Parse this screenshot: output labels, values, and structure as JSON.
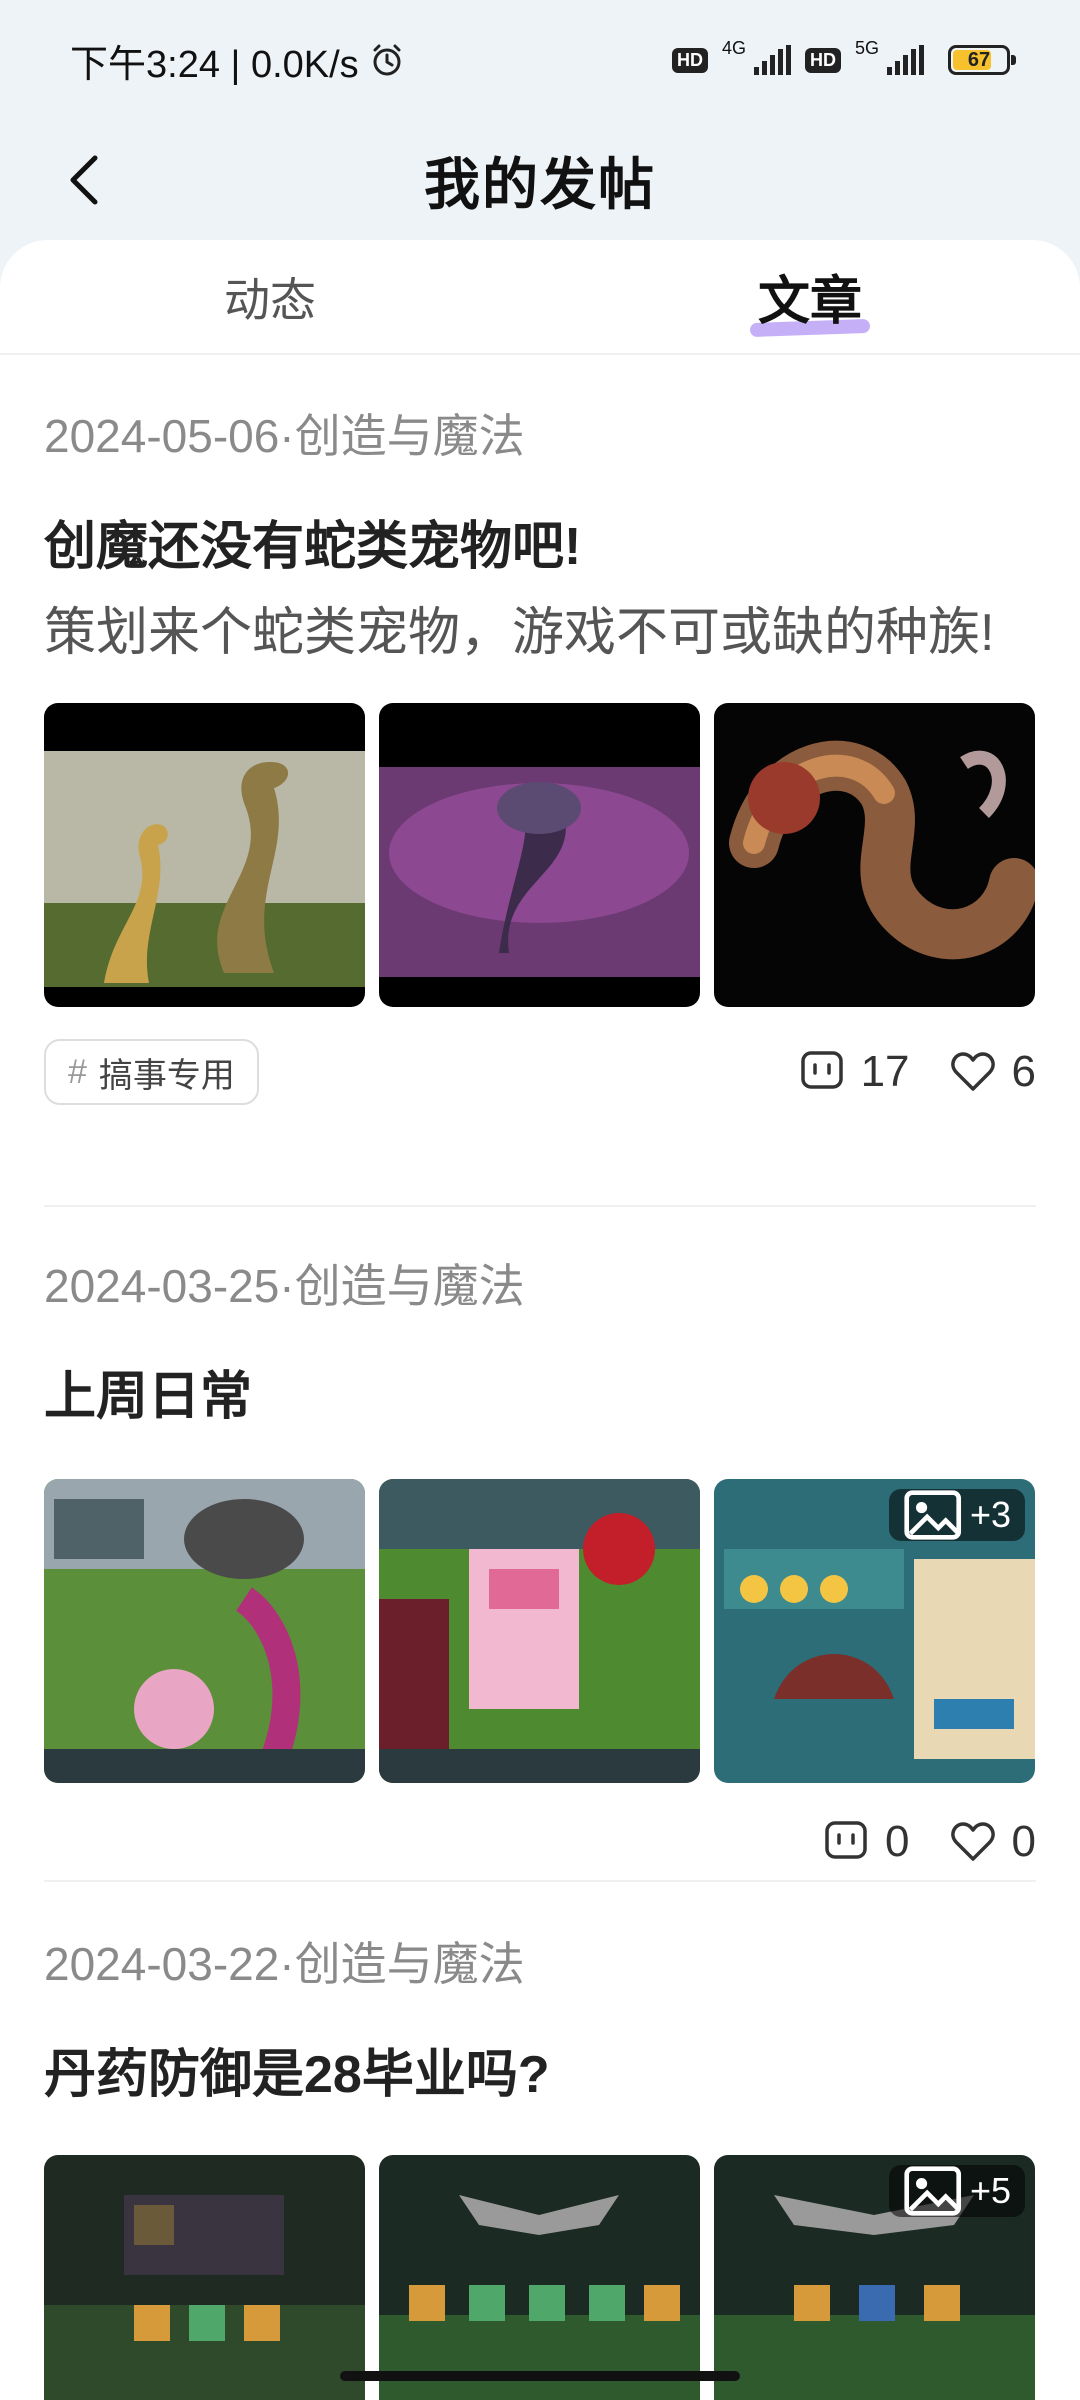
{
  "status_bar": {
    "time_speed": "下午3:24 | 0.0K/s",
    "hd1": "HD",
    "net1": "4G",
    "hd2": "HD",
    "net2": "5G",
    "battery": "67"
  },
  "header": {
    "title": "我的发帖"
  },
  "tabs": [
    {
      "label": "动态",
      "active": false
    },
    {
      "label": "文章",
      "active": true
    }
  ],
  "posts": [
    {
      "meta": "2024-05-06·创造与魔法",
      "title": "创魔还没有蛇类宠物吧!",
      "body": "策划来个蛇类宠物，游戏不可或缺的种族!",
      "tag": "搞事专用",
      "comments": "17",
      "likes": "6",
      "images": [
        "golden-cobra-image",
        "purple-serpent-image",
        "dragon-serpent-image"
      ]
    },
    {
      "meta": "2024-03-25·创造与魔法",
      "title": "上周日常",
      "comments": "0",
      "likes": "0",
      "more_count": "+3",
      "images": [
        "game-screenshot-1",
        "game-screenshot-2",
        "game-screenshot-3"
      ]
    },
    {
      "meta": "2024-03-22·创造与魔法",
      "title": "丹药防御是28毕业吗?",
      "more_count": "+5",
      "images": [
        "crafting-screenshot-1",
        "crafting-screenshot-2",
        "crafting-screenshot-3"
      ]
    }
  ]
}
